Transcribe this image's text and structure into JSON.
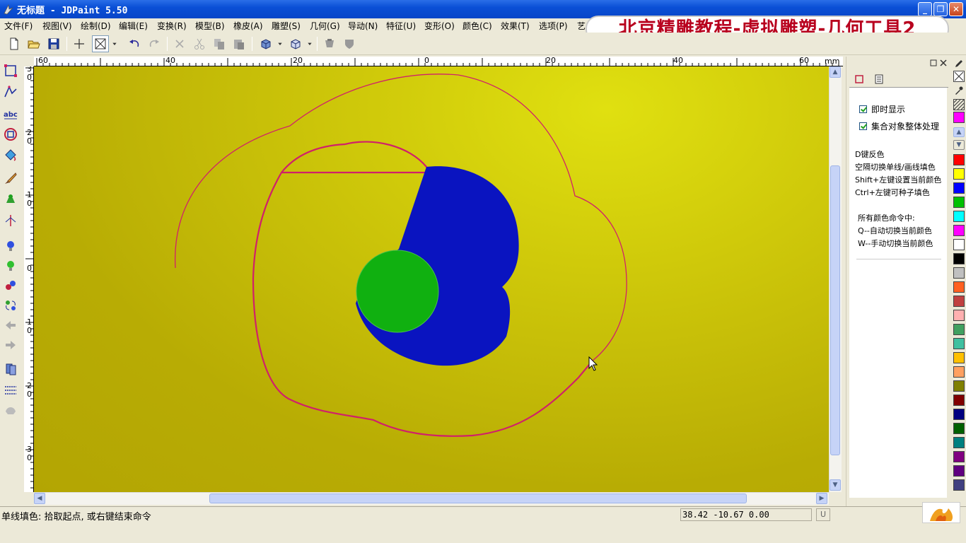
{
  "window": {
    "title": "无标题 - JDPaint 5.50",
    "minimize": "_",
    "maximize": "❐",
    "close": "✕"
  },
  "menu": [
    "文件(F)",
    "视图(V)",
    "绘制(D)",
    "编辑(E)",
    "变换(R)",
    "模型(B)",
    "橡皮(A)",
    "雕塑(S)",
    "几何(G)",
    "导动(N)",
    "特征(U)",
    "变形(O)",
    "颜色(C)",
    "效果(T)",
    "选项(P)",
    "艺"
  ],
  "banner": "北京精雕教程-虚拟雕塑-几何工具2",
  "ruler": {
    "unit": "mm",
    "h_labels": [
      "60",
      "40",
      "20",
      "0",
      "20",
      "40",
      "60"
    ],
    "v_labels": [
      "3\n0",
      "2\n0",
      "1\n0",
      "0",
      "1\n0",
      "2\n0",
      "3\n0"
    ]
  },
  "right_panel": {
    "options": [
      "即时显示",
      "集合对象整体处理"
    ],
    "hints": [
      "D键反色",
      "空隔切换单线/画线填色",
      "Shift+左键设置当前颜色",
      "Ctrl+左键可种子填色",
      "所有颜色命令中:",
      "Q--自动切换当前颜色",
      "W--手动切换当前颜色"
    ]
  },
  "palette": [
    "#ff00ff",
    "#ff0000",
    "#ffff00",
    "#0000ff",
    "#00c000",
    "#00ffff",
    "#ff00ff",
    "#ffffff",
    "#000000",
    "#c0c0c0",
    "#ff6020",
    "#c04040",
    "#ffb0b0",
    "#40a060",
    "#40c0a0",
    "#ffc000",
    "#ffa060",
    "#808000",
    "#800000",
    "#000080",
    "#006000",
    "#008080",
    "#800080",
    "#600080",
    "#404080"
  ],
  "status": {
    "prompt": "单线填色: 拾取起点, 或右键结束命令",
    "coords": "38.42 -10.67 0.00",
    "u_button": "U"
  },
  "canvas": {
    "background": "#b8ac04",
    "curve_color": "#d0206a",
    "blue_shape": "#0a14c0",
    "green_disc": "#10b010"
  }
}
